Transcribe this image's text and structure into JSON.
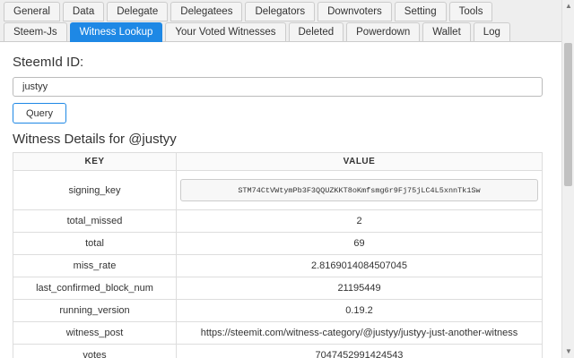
{
  "tabs_row1": [
    {
      "label": "General",
      "active": false
    },
    {
      "label": "Data",
      "active": false
    },
    {
      "label": "Delegate",
      "active": false
    },
    {
      "label": "Delegatees",
      "active": false
    },
    {
      "label": "Delegators",
      "active": false
    },
    {
      "label": "Downvoters",
      "active": false
    },
    {
      "label": "Setting",
      "active": false
    },
    {
      "label": "Tools",
      "active": false
    }
  ],
  "tabs_row2": [
    {
      "label": "Steem-Js",
      "active": false
    },
    {
      "label": "Witness Lookup",
      "active": true
    },
    {
      "label": "Your Voted Witnesses",
      "active": false
    },
    {
      "label": "Deleted",
      "active": false
    },
    {
      "label": "Powerdown",
      "active": false
    },
    {
      "label": "Wallet",
      "active": false
    },
    {
      "label": "Log",
      "active": false
    }
  ],
  "form": {
    "label": "SteemId ID:",
    "input_value": "justyy",
    "query_label": "Query"
  },
  "details": {
    "title": "Witness Details for @justyy",
    "col_key": "KEY",
    "col_value": "VALUE",
    "rows": [
      {
        "key": "signing_key",
        "value": "STM74CtVWtymPb3F3QQUZKKT8oKmfsmg6r9Fj75jLC4L5xnnTk1Sw",
        "boxed": true
      },
      {
        "key": "total_missed",
        "value": "2"
      },
      {
        "key": "total",
        "value": "69"
      },
      {
        "key": "miss_rate",
        "value": "2.8169014084507045"
      },
      {
        "key": "last_confirmed_block_num",
        "value": "21195449"
      },
      {
        "key": "running_version",
        "value": "0.19.2"
      },
      {
        "key": "witness_post",
        "value": "https://steemit.com/witness-category/@justyy/justyy-just-another-witness"
      },
      {
        "key": "votes",
        "value": "7047452991424543"
      }
    ]
  },
  "icons": {
    "scroll_up": "triangle-up",
    "scroll_down": "triangle-down"
  }
}
